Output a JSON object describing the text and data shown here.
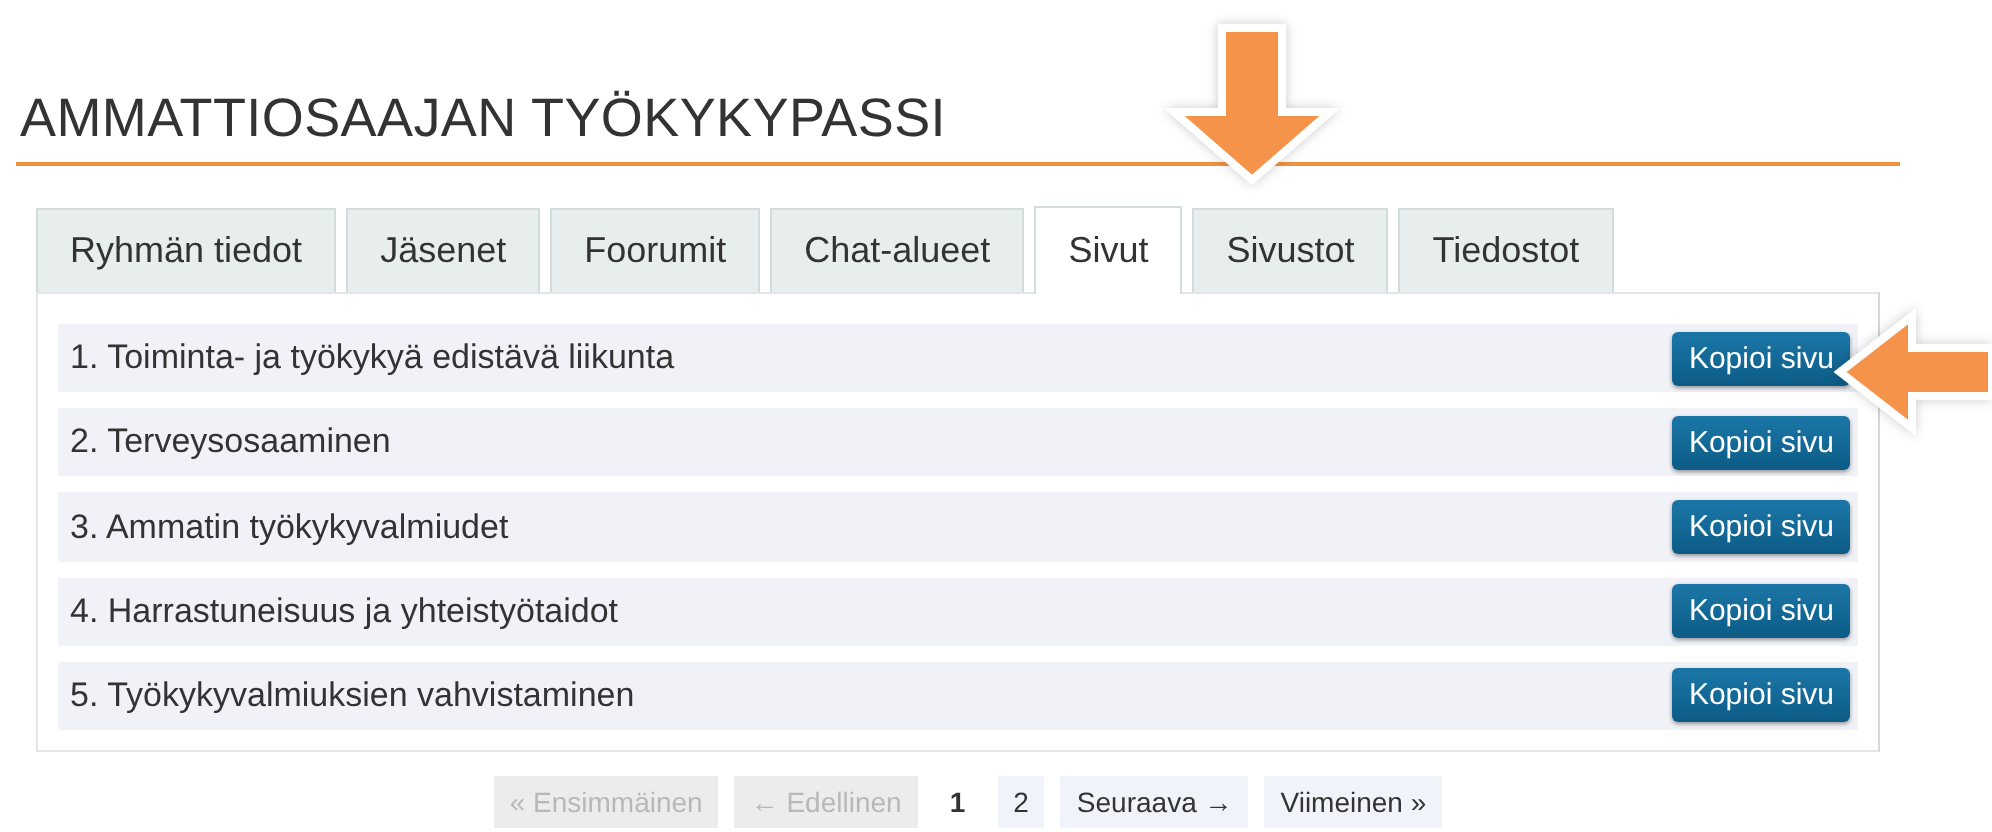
{
  "title": "AMMATTIOSAAJAN TYÖKYKYPASSI",
  "tabs": [
    {
      "label": "Ryhmän tiedot",
      "selected": false
    },
    {
      "label": "Jäsenet",
      "selected": false
    },
    {
      "label": "Foorumit",
      "selected": false
    },
    {
      "label": "Chat-alueet",
      "selected": false
    },
    {
      "label": "Sivut",
      "selected": true
    },
    {
      "label": "Sivustot",
      "selected": false
    },
    {
      "label": "Tiedostot",
      "selected": false
    }
  ],
  "pages": [
    {
      "title": "1. Toiminta- ja työkykyä edistävä liikunta",
      "button": "Kopioi sivu"
    },
    {
      "title": "2. Terveysosaaminen",
      "button": "Kopioi sivu"
    },
    {
      "title": "3. Ammatin työkykyvalmiudet",
      "button": "Kopioi sivu"
    },
    {
      "title": "4. Harrastuneisuus ja yhteistyötaidot",
      "button": "Kopioi sivu"
    },
    {
      "title": "5. Työkykyvalmiuksien vahvistaminen",
      "button": "Kopioi sivu"
    }
  ],
  "pagination": [
    {
      "label": "« Ensimmäinen",
      "disabled": true,
      "selected": false
    },
    {
      "label": "← Edellinen",
      "disabled": true,
      "selected": false
    },
    {
      "label": "1",
      "disabled": false,
      "selected": true
    },
    {
      "label": "2",
      "disabled": false,
      "selected": false
    },
    {
      "label": "Seuraava →",
      "disabled": false,
      "selected": false
    },
    {
      "label": "Viimeinen »",
      "disabled": false,
      "selected": false
    }
  ]
}
